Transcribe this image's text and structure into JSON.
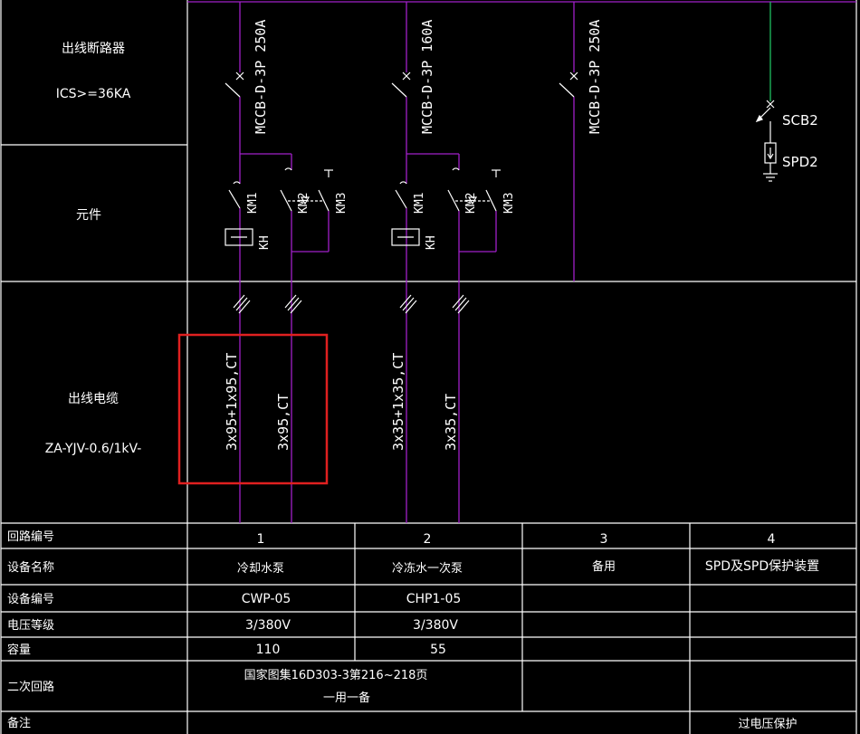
{
  "left_labels": {
    "breaker_title": "出线断路器",
    "breaker_rating": "ICS>=36KA",
    "component_title": "元件",
    "cable_title": "出线电缆",
    "cable_spec": "ZA-YJV-0.6/1kV-"
  },
  "circuits": [
    {
      "breaker": "MCCB-D-3P 250A",
      "km1": "KM1",
      "km2": "KM2",
      "km3": "KM3",
      "kh": "KH",
      "cable_a": "3x95+1x95,CT",
      "cable_b": "3x95,CT"
    },
    {
      "breaker": "MCCB-D-3P 160A",
      "km1": "KM1",
      "km2": "KM2",
      "km3": "KM3",
      "kh": "KH",
      "cable_a": "3x35+1x35,CT",
      "cable_b": "3x35,CT"
    },
    {
      "breaker": "MCCB-D-3P 250A"
    }
  ],
  "spd": {
    "scb": "SCB2",
    "spd": "SPD2"
  },
  "table": {
    "row_headers": [
      "回路编号",
      "设备名称",
      "设备编号",
      "电压等级",
      "容量",
      "二次回路",
      "备注"
    ],
    "circuit_numbers": [
      "1",
      "2",
      "3",
      "4"
    ],
    "device_names": [
      "冷却水泵",
      "冷冻水一次泵",
      "备用",
      "SPD及SPD保护装置"
    ],
    "device_codes": [
      "CWP-05",
      "CHP1-05",
      "",
      ""
    ],
    "voltages": [
      "3/380V",
      "3/380V",
      "",
      ""
    ],
    "capacities": [
      "110",
      "55",
      "",
      ""
    ],
    "secondary_line1": "国家图集16D303-3第216~218页",
    "secondary_line2": "一用一备",
    "remarks": [
      "",
      "",
      "",
      "过电压保护"
    ]
  },
  "colors": {
    "bus": "#a020c8",
    "spd_line": "#20c060",
    "grid": "#ffffff",
    "highlight": "#e02020"
  }
}
